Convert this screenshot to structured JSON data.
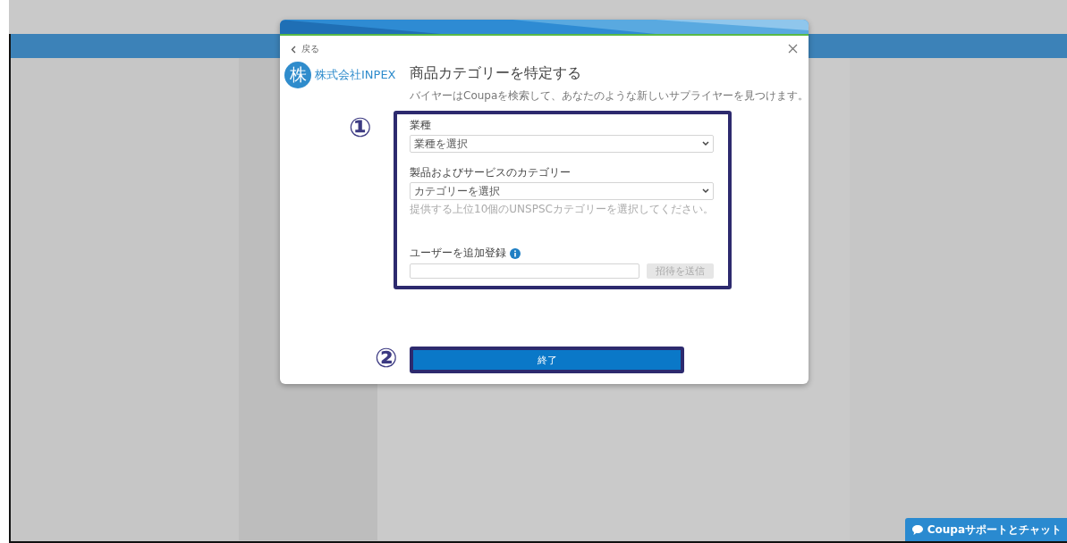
{
  "modal": {
    "back_link": "戻る",
    "logo_mark": "株",
    "logo_text": "株式会社INPEX",
    "title": "商品カテゴリーを特定する",
    "subtitle": "バイヤーはCoupaを検索して、あなたのような新しいサプライヤーを見つけます。",
    "fields": [
      {
        "kind": "select",
        "label": "業種",
        "value": "業種を選択"
      },
      {
        "kind": "select",
        "label": "製品およびサービスのカテゴリー",
        "value": "カテゴリーを選択",
        "hint": "提供する上位10個のUNSPSCカテゴリーを選択してください。"
      },
      {
        "kind": "invite",
        "label": "ユーザーを追加登録",
        "button": "招待を送信",
        "button_disabled": true
      }
    ],
    "finish_button": "終了"
  },
  "annotations": [
    {
      "label": "①"
    },
    {
      "label": "②"
    }
  ],
  "chat_button": "Coupaサポートとチャット"
}
